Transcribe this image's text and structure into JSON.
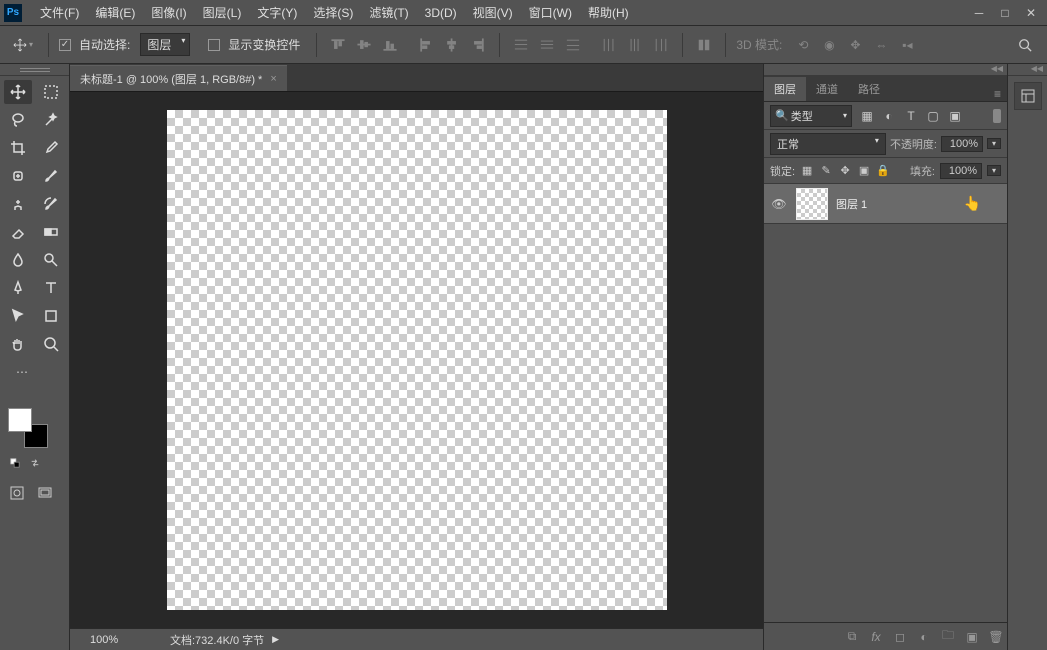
{
  "app": {
    "logo": "Ps"
  },
  "menu": {
    "file": "文件(F)",
    "edit": "编辑(E)",
    "image": "图像(I)",
    "layer": "图层(L)",
    "text": "文字(Y)",
    "select": "选择(S)",
    "filter": "滤镜(T)",
    "threed": "3D(D)",
    "view": "视图(V)",
    "window": "窗口(W)",
    "help": "帮助(H)"
  },
  "options": {
    "auto_select": "自动选择:",
    "auto_select_target": "图层",
    "show_transform": "显示变换控件",
    "threed_mode": "3D 模式:"
  },
  "document": {
    "tab_title": "未标题-1 @ 100% (图层 1, RGB/8#) *",
    "zoom": "100%",
    "status": "文档:732.4K/0 字节"
  },
  "panels": {
    "tabs": {
      "layers": "图层",
      "channels": "通道",
      "paths": "路径"
    },
    "filter_label": "类型",
    "blend_mode": "正常",
    "opacity_label": "不透明度:",
    "opacity_value": "100%",
    "lock_label": "锁定:",
    "fill_label": "填充:",
    "fill_value": "100%",
    "layer1": {
      "name": "图层 1"
    }
  }
}
